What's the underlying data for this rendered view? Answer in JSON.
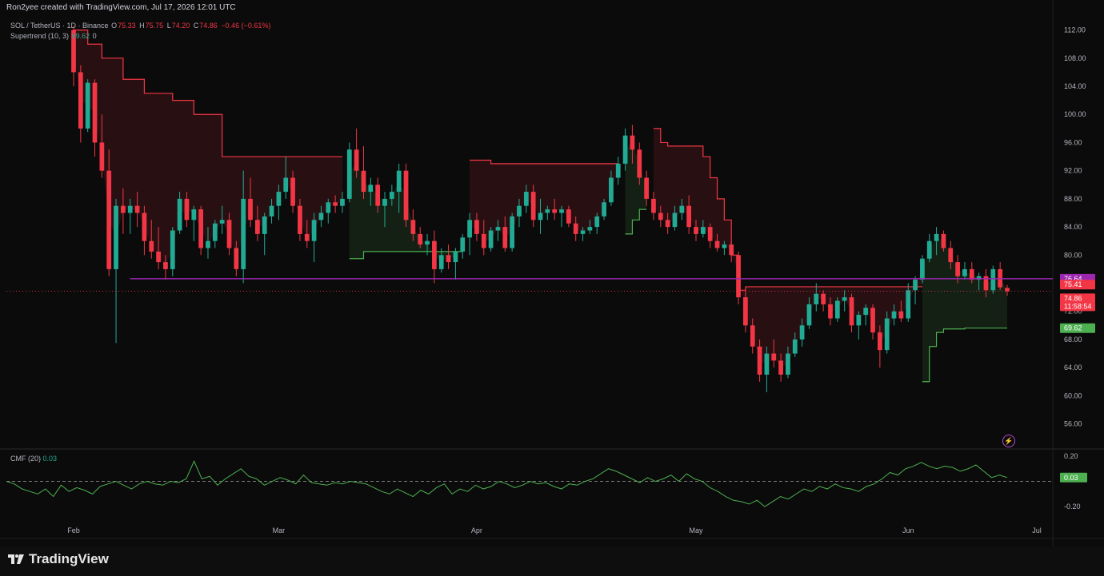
{
  "header": {
    "credit": "Ron2yee created with TradingView.com, Jul 17, 2026 12:01 UTC"
  },
  "legend": {
    "symbol": "SOL / TetherUS · 1D · Binance",
    "o_label": "O",
    "o_value": "75.33",
    "h_label": "H",
    "h_value": "75.75",
    "l_label": "L",
    "l_value": "74.20",
    "c_label": "C",
    "c_value": "74.86",
    "change": "−0.46 (−0.61%)",
    "supertrend_label": "Supertrend (10, 3)",
    "supertrend_value": "69.62",
    "supertrend_extra": "0"
  },
  "cmf": {
    "label": "CMF (20)",
    "value": "0.03"
  },
  "price_axis": {
    "ticks": [
      "112.00",
      "108.00",
      "104.00",
      "100.00",
      "96.00",
      "92.00",
      "88.00",
      "84.00",
      "80.00",
      "72.00",
      "68.00",
      "64.00",
      "60.00",
      "56.00"
    ],
    "tick_values": [
      112,
      108,
      104,
      100,
      96,
      92,
      88,
      84,
      80,
      72,
      68,
      64,
      60,
      56
    ],
    "ylim": [
      53,
      114
    ]
  },
  "cmf_axis": {
    "ticks": [
      "0.20",
      "-0.20"
    ],
    "tick_values": [
      0.2,
      -0.2
    ],
    "ylim": [
      -0.3,
      0.25
    ]
  },
  "badges": {
    "horizontal_line": {
      "text": "76.64",
      "value": 76.64,
      "color": "#9c27b0"
    },
    "prev_close": {
      "text": "75.41",
      "value": 75.41,
      "color": "#f23645"
    },
    "last_price": {
      "text": "74.86",
      "value": 74.86,
      "color": "#f23645"
    },
    "countdown": "11:58:54",
    "supertrend": {
      "text": "69.62",
      "value": 69.62,
      "color": "#4caf50"
    },
    "cmf": {
      "text": "0.03",
      "value": 0.03,
      "color": "#4caf50"
    }
  },
  "time_axis": {
    "labels": [
      "Feb",
      "Mar",
      "Apr",
      "May",
      "Jun",
      "Jul"
    ]
  },
  "brand": {
    "name": "TradingView"
  },
  "colors": {
    "up": "#22ab94",
    "down": "#f23645",
    "background": "#0b0b0b",
    "hline": "#9c27b0",
    "cmf_line": "#4caf50"
  },
  "chart_data": {
    "type": "candlestick",
    "symbol": "SOL / TetherUS",
    "interval": "1D",
    "ohlc_approx_daily": [
      [
        112.0,
        112.5,
        104.0,
        106.0
      ],
      [
        106.0,
        107.0,
        96.0,
        98.0
      ],
      [
        98.0,
        105.0,
        97.5,
        104.5
      ],
      [
        104.5,
        105.0,
        94.0,
        96.0
      ],
      [
        96.0,
        100.0,
        91.0,
        92.0
      ],
      [
        92.0,
        95.0,
        77.0,
        78.0
      ],
      [
        78.0,
        88.0,
        67.5,
        87.0
      ],
      [
        87.0,
        89.5,
        83.0,
        86.0
      ],
      [
        86.0,
        88.0,
        83.0,
        87.0
      ],
      [
        87.0,
        89.0,
        84.0,
        86.0
      ],
      [
        86.0,
        87.0,
        80.0,
        82.0
      ],
      [
        82.0,
        85.0,
        79.5,
        80.5
      ],
      [
        80.5,
        84.0,
        78.0,
        79.0
      ],
      [
        79.0,
        80.0,
        76.5,
        78.0
      ],
      [
        78.0,
        84.0,
        77.0,
        83.5
      ],
      [
        83.5,
        89.0,
        83.0,
        88.0
      ],
      [
        88.0,
        89.0,
        84.0,
        85.0
      ],
      [
        85.0,
        87.0,
        82.0,
        86.5
      ],
      [
        86.5,
        87.0,
        80.0,
        81.0
      ],
      [
        81.0,
        84.0,
        79.5,
        82.0
      ],
      [
        82.0,
        85.0,
        81.0,
        84.5
      ],
      [
        84.5,
        87.0,
        83.0,
        85.0
      ],
      [
        85.0,
        86.0,
        80.0,
        81.0
      ],
      [
        81.0,
        82.0,
        77.0,
        78.0
      ],
      [
        78.0,
        92.0,
        76.0,
        88.0
      ],
      [
        88.0,
        91.0,
        84.0,
        85.0
      ],
      [
        85.0,
        87.0,
        82.0,
        83.0
      ],
      [
        83.0,
        86.0,
        80.0,
        85.5
      ],
      [
        85.5,
        88.0,
        84.5,
        87.0
      ],
      [
        87.0,
        90.0,
        85.0,
        89.0
      ],
      [
        89.0,
        94.0,
        88.0,
        91.0
      ],
      [
        91.0,
        92.0,
        86.0,
        87.0
      ],
      [
        87.0,
        88.0,
        82.0,
        83.0
      ],
      [
        83.0,
        85.0,
        81.0,
        82.0
      ],
      [
        82.0,
        86.0,
        79.0,
        85.0
      ],
      [
        85.0,
        87.0,
        84.0,
        86.0
      ],
      [
        86.0,
        88.0,
        84.5,
        87.5
      ],
      [
        87.5,
        88.5,
        86.0,
        87.0
      ],
      [
        87.0,
        89.0,
        86.0,
        88.0
      ],
      [
        88.0,
        96.0,
        87.5,
        95.0
      ],
      [
        95.0,
        98.0,
        91.0,
        92.0
      ],
      [
        92.0,
        95.5,
        88.0,
        89.0
      ],
      [
        89.0,
        91.0,
        87.0,
        90.0
      ],
      [
        90.0,
        91.0,
        86.0,
        87.0
      ],
      [
        87.0,
        89.0,
        84.0,
        88.0
      ],
      [
        88.0,
        90.0,
        87.0,
        89.0
      ],
      [
        89.0,
        93.0,
        86.0,
        92.0
      ],
      [
        92.0,
        93.0,
        84.0,
        85.0
      ],
      [
        85.0,
        86.5,
        82.0,
        83.0
      ],
      [
        83.0,
        84.0,
        81.0,
        81.5
      ],
      [
        81.5,
        83.0,
        80.0,
        82.0
      ],
      [
        82.0,
        83.5,
        76.0,
        78.0
      ],
      [
        78.0,
        81.0,
        77.5,
        80.0
      ],
      [
        80.0,
        81.5,
        78.0,
        79.0
      ],
      [
        79.0,
        81.0,
        76.5,
        80.5
      ],
      [
        80.5,
        83.0,
        79.5,
        82.5
      ],
      [
        82.5,
        86.0,
        80.0,
        85.0
      ],
      [
        85.0,
        86.0,
        82.0,
        83.0
      ],
      [
        83.0,
        85.0,
        80.0,
        81.0
      ],
      [
        81.0,
        84.0,
        80.5,
        83.5
      ],
      [
        83.5,
        85.0,
        82.0,
        84.0
      ],
      [
        84.0,
        85.5,
        80.5,
        81.0
      ],
      [
        81.0,
        86.0,
        80.5,
        85.5
      ],
      [
        85.5,
        88.0,
        84.0,
        87.0
      ],
      [
        87.0,
        90.0,
        86.0,
        89.0
      ],
      [
        89.0,
        90.0,
        84.0,
        85.0
      ],
      [
        85.0,
        88.0,
        83.0,
        86.0
      ],
      [
        86.0,
        87.0,
        85.0,
        86.5
      ],
      [
        86.5,
        88.0,
        85.0,
        86.0
      ],
      [
        86.0,
        87.0,
        84.0,
        86.5
      ],
      [
        86.5,
        87.0,
        84.0,
        84.5
      ],
      [
        84.5,
        85.5,
        82.0,
        83.0
      ],
      [
        83.0,
        84.0,
        82.0,
        83.5
      ],
      [
        83.5,
        85.0,
        83.0,
        84.0
      ],
      [
        84.0,
        86.0,
        83.0,
        85.5
      ],
      [
        85.5,
        88.0,
        85.0,
        87.5
      ],
      [
        87.5,
        92.0,
        87.0,
        91.0
      ],
      [
        91.0,
        94.0,
        90.0,
        93.0
      ],
      [
        93.0,
        98.0,
        92.0,
        97.0
      ],
      [
        97.0,
        98.5,
        93.0,
        95.0
      ],
      [
        95.0,
        96.0,
        90.0,
        91.0
      ],
      [
        91.0,
        92.0,
        87.0,
        88.0
      ],
      [
        88.0,
        89.0,
        85.0,
        86.0
      ],
      [
        86.0,
        87.0,
        84.0,
        85.0
      ],
      [
        85.0,
        86.0,
        83.0,
        84.0
      ],
      [
        84.0,
        87.0,
        83.5,
        86.0
      ],
      [
        86.0,
        88.0,
        85.0,
        87.0
      ],
      [
        87.0,
        88.5,
        83.0,
        84.0
      ],
      [
        84.0,
        85.0,
        82.0,
        83.0
      ],
      [
        83.0,
        85.0,
        82.5,
        84.0
      ],
      [
        84.0,
        84.5,
        81.0,
        82.0
      ],
      [
        82.0,
        83.0,
        80.5,
        81.0
      ],
      [
        81.0,
        82.0,
        80.0,
        81.5
      ],
      [
        81.5,
        82.0,
        79.0,
        80.0
      ],
      [
        80.0,
        80.5,
        73.0,
        74.0
      ],
      [
        74.0,
        75.0,
        69.0,
        70.0
      ],
      [
        70.0,
        71.0,
        66.0,
        67.0
      ],
      [
        67.0,
        68.0,
        62.0,
        63.0
      ],
      [
        63.0,
        67.0,
        60.5,
        66.0
      ],
      [
        66.0,
        68.0,
        64.0,
        65.0
      ],
      [
        65.0,
        66.0,
        62.0,
        63.0
      ],
      [
        63.0,
        67.0,
        62.5,
        66.0
      ],
      [
        66.0,
        69.0,
        65.5,
        68.0
      ],
      [
        68.0,
        71.0,
        67.0,
        70.0
      ],
      [
        70.0,
        74.0,
        69.5,
        73.0
      ],
      [
        73.0,
        76.0,
        72.0,
        74.5
      ],
      [
        74.5,
        75.0,
        72.0,
        73.0
      ],
      [
        73.0,
        74.0,
        70.0,
        71.0
      ],
      [
        71.0,
        74.0,
        70.5,
        73.5
      ],
      [
        73.5,
        75.0,
        72.0,
        74.0
      ],
      [
        74.0,
        74.5,
        69.0,
        70.0
      ],
      [
        70.0,
        72.0,
        68.0,
        71.5
      ],
      [
        71.5,
        73.0,
        70.0,
        72.5
      ],
      [
        72.5,
        73.0,
        68.0,
        69.0
      ],
      [
        69.0,
        70.0,
        64.0,
        66.5
      ],
      [
        66.5,
        72.0,
        66.0,
        71.0
      ],
      [
        71.0,
        73.0,
        70.0,
        72.0
      ],
      [
        72.0,
        73.5,
        70.5,
        71.0
      ],
      [
        71.0,
        76.0,
        70.5,
        75.0
      ],
      [
        75.0,
        77.0,
        73.0,
        76.5
      ],
      [
        76.5,
        80.0,
        76.0,
        79.5
      ],
      [
        79.5,
        83.0,
        79.0,
        82.0
      ],
      [
        82.0,
        84.0,
        80.0,
        83.0
      ],
      [
        83.0,
        83.5,
        80.5,
        81.0
      ],
      [
        81.0,
        82.0,
        78.0,
        79.0
      ],
      [
        79.0,
        80.0,
        76.0,
        77.0
      ],
      [
        77.0,
        79.0,
        76.5,
        78.0
      ],
      [
        78.0,
        79.0,
        76.0,
        76.5
      ],
      [
        76.5,
        77.5,
        75.0,
        77.0
      ],
      [
        77.0,
        78.0,
        74.0,
        75.0
      ],
      [
        75.0,
        78.5,
        74.5,
        78.0
      ],
      [
        78.0,
        79.0,
        75.0,
        75.41
      ],
      [
        75.33,
        75.75,
        74.2,
        74.86
      ]
    ],
    "supertrend_segments": [
      {
        "trend": "down",
        "start_index": 0,
        "levels": [
          112,
          112,
          110,
          110,
          108,
          108,
          108,
          105,
          105,
          105,
          103,
          103,
          103,
          103,
          102,
          102,
          102,
          100,
          100,
          100,
          100,
          94,
          94,
          94,
          94,
          94,
          94,
          94,
          94,
          94,
          94,
          94,
          94,
          94,
          94,
          94,
          94,
          94,
          94
        ]
      },
      {
        "trend": "up",
        "start_index": 39,
        "levels": [
          79.5,
          79.5,
          80.5,
          80.5,
          80.5,
          80.5,
          80.5,
          80.5,
          80.5,
          80.5,
          80.5,
          80.5,
          80.5,
          80.5,
          80.5,
          80.5,
          80.5
        ]
      },
      {
        "trend": "down",
        "start_index": 56,
        "levels": [
          93.5,
          93.5,
          93.5,
          93,
          93,
          93,
          93,
          93,
          93,
          93,
          93,
          93,
          93,
          93,
          93,
          93,
          93,
          93,
          93,
          93,
          93,
          93
        ]
      },
      {
        "trend": "up",
        "start_index": 78,
        "levels": [
          83,
          85,
          86.5,
          86.5
        ]
      },
      {
        "trend": "down",
        "start_index": 82,
        "levels": [
          98,
          96,
          95.5,
          95.5,
          95.5,
          95.5,
          95.5,
          94,
          91,
          88,
          85,
          80,
          75,
          75.5,
          75.5,
          75.5,
          75.5,
          75.5,
          75.5,
          75.5,
          75.5,
          75.5,
          75.5,
          75.5,
          75.5,
          75.5,
          75.5,
          75.5,
          75.5,
          75.5,
          75.5,
          75.5,
          75.5,
          75.5,
          75.5,
          75.5,
          75.5,
          75.5,
          75.5
        ]
      },
      {
        "trend": "up",
        "start_index": 120,
        "levels": [
          62,
          67,
          69,
          69.5,
          69.5,
          69.5,
          69.62,
          69.62,
          69.62,
          69.62,
          69.62,
          69.62,
          69.62,
          69.62,
          69.62
        ]
      }
    ],
    "horizontal_line": 76.64,
    "cmf_series": [
      0.0,
      -0.02,
      -0.06,
      -0.08,
      -0.1,
      -0.06,
      -0.12,
      -0.03,
      -0.08,
      -0.05,
      -0.07,
      -0.1,
      -0.04,
      -0.02,
      0.0,
      -0.03,
      -0.06,
      -0.02,
      0.0,
      -0.02,
      -0.03,
      0.0,
      -0.01,
      0.02,
      0.16,
      0.02,
      0.04,
      -0.03,
      0.02,
      0.06,
      0.1,
      0.04,
      0.02,
      -0.03,
      0.0,
      0.03,
      0.01,
      -0.02,
      0.05,
      -0.01,
      -0.02,
      -0.03,
      -0.01,
      -0.02,
      0.0,
      -0.01,
      -0.02,
      -0.05,
      -0.08,
      -0.1,
      -0.06,
      -0.09,
      -0.12,
      -0.07,
      -0.1,
      -0.05,
      -0.02,
      -0.1,
      -0.06,
      -0.08,
      -0.03,
      -0.06,
      -0.04,
      0.0,
      -0.02,
      -0.05,
      -0.03,
      0.0,
      -0.02,
      -0.01,
      -0.04,
      -0.06,
      -0.02,
      -0.03,
      0.0,
      0.02,
      0.06,
      0.1,
      0.08,
      0.05,
      0.02,
      -0.01,
      0.03,
      0.0,
      0.02,
      0.05,
      0.0,
      0.06,
      0.02,
      0.0,
      -0.05,
      -0.08,
      -0.12,
      -0.15,
      -0.16,
      -0.18,
      -0.15,
      -0.2,
      -0.16,
      -0.12,
      -0.14,
      -0.1,
      -0.06,
      -0.08,
      -0.04,
      -0.06,
      -0.02,
      -0.05,
      -0.06,
      -0.08,
      -0.04,
      -0.02,
      0.02,
      0.07,
      0.05,
      0.1,
      0.12,
      0.15,
      0.12,
      0.1,
      0.12,
      0.11,
      0.08,
      0.1,
      0.13,
      0.08,
      0.03,
      0.05,
      0.03
    ]
  }
}
